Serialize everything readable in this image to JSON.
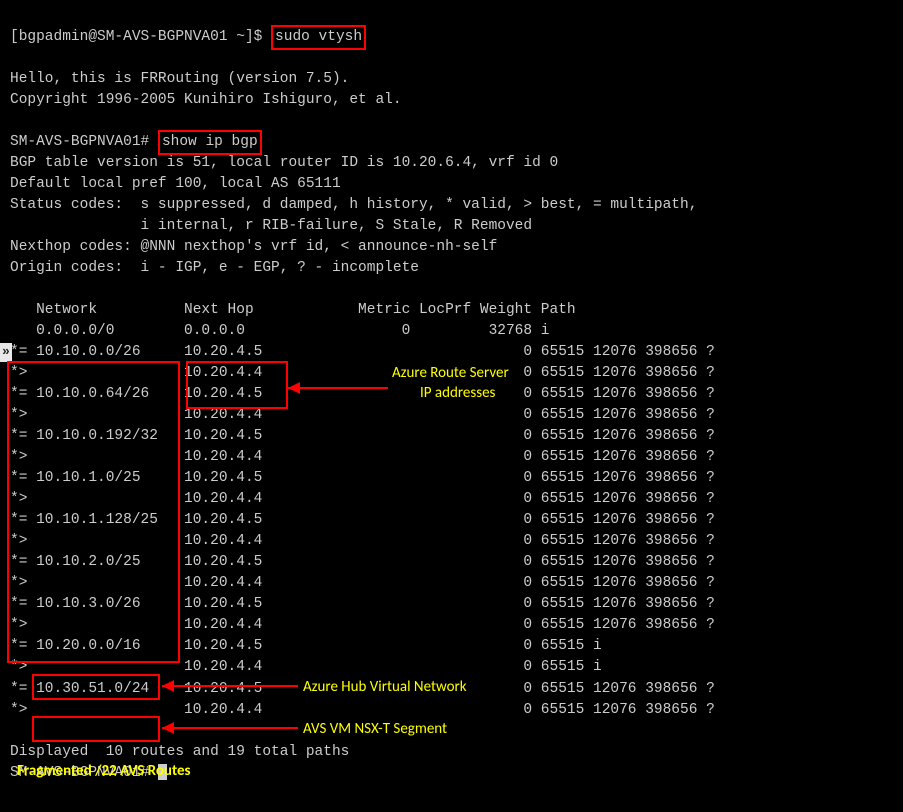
{
  "shell_prompt": "[bgpadmin@SM-AVS-BGPNVA01 ~]$ ",
  "cmd1": "sudo vtysh",
  "banner_line1": "Hello, this is FRRouting (version 7.5).",
  "banner_line2": "Copyright 1996-2005 Kunihiro Ishiguro, et al.",
  "frr_prompt": "SM-AVS-BGPNVA01# ",
  "cmd2": "show ip bgp",
  "bgp_line1": "BGP table version is 51, local router ID is 10.20.6.4, vrf id 0",
  "bgp_line2": "Default local pref 100, local AS 65111",
  "status_codes_l1": "Status codes:  s suppressed, d damped, h history, * valid, > best, = multipath,",
  "status_codes_l2": "               i internal, r RIB-failure, S Stale, R Removed",
  "nexthop_codes": "Nexthop codes: @NNN nexthop's vrf id, < announce-nh-self",
  "origin_codes": "Origin codes:  i - IGP, e - EGP, ? - incomplete",
  "header_row": "   Network          Next Hop            Metric LocPrf Weight Path",
  "rows": [
    "   0.0.0.0/0        0.0.0.0                  0         32768 i",
    "*= 10.10.0.0/26     10.20.4.5                              0 65515 12076 398656 ?",
    "*>                  10.20.4.4                              0 65515 12076 398656 ?",
    "*= 10.10.0.64/26    10.20.4.5                              0 65515 12076 398656 ?",
    "*>                  10.20.4.4                              0 65515 12076 398656 ?",
    "*= 10.10.0.192/32   10.20.4.5                              0 65515 12076 398656 ?",
    "*>                  10.20.4.4                              0 65515 12076 398656 ?",
    "*= 10.10.1.0/25     10.20.4.5                              0 65515 12076 398656 ?",
    "*>                  10.20.4.4                              0 65515 12076 398656 ?",
    "*= 10.10.1.128/25   10.20.4.5                              0 65515 12076 398656 ?",
    "*>                  10.20.4.4                              0 65515 12076 398656 ?",
    "*= 10.10.2.0/25     10.20.4.5                              0 65515 12076 398656 ?",
    "*>                  10.20.4.4                              0 65515 12076 398656 ?",
    "*= 10.10.3.0/26     10.20.4.5                              0 65515 12076 398656 ?",
    "*>                  10.20.4.4                              0 65515 12076 398656 ?",
    "*= 10.20.0.0/16     10.20.4.5                              0 65515 i",
    "*>                  10.20.4.4                              0 65515 i",
    "*= 10.30.51.0/24    10.20.4.5                              0 65515 12076 398656 ?",
    "*>                  10.20.4.4                              0 65515 12076 398656 ?"
  ],
  "displayed_line": "Displayed  10 routes and 19 total paths",
  "final_prompt": "SM-AVS-BGPNVA01# ",
  "annot_routeserver_l1": "Azure Route Server",
  "annot_routeserver_l2": "IP addresses",
  "annot_hubvnet": "Azure Hub Virtual Network",
  "annot_nsxt": "AVS VM NSX-T Segment",
  "annot_fragmented": "Fragmented /22 AVS Routes"
}
